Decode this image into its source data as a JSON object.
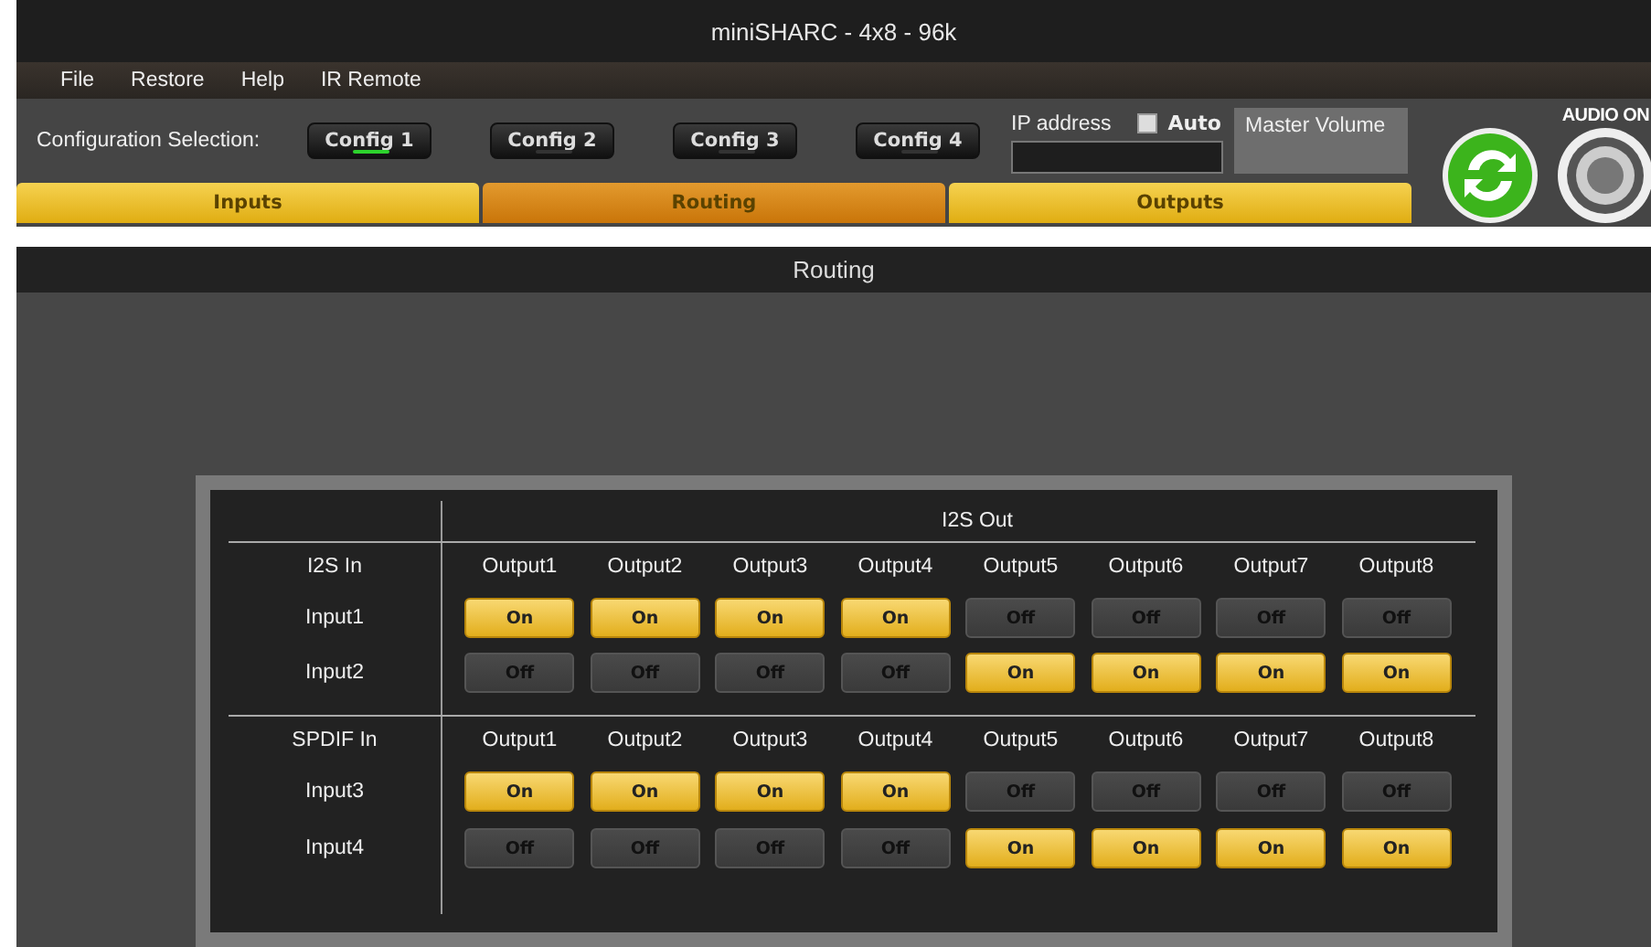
{
  "window": {
    "title": "miniSHARC - 4x8 - 96k"
  },
  "menu": [
    "File",
    "Restore",
    "Help",
    "IR Remote"
  ],
  "configuration": {
    "label": "Configuration Selection:",
    "presets": [
      {
        "label": "Config 1",
        "selected": true
      },
      {
        "label": "Config 2",
        "selected": false
      },
      {
        "label": "Config 3",
        "selected": false
      },
      {
        "label": "Config 4",
        "selected": false
      }
    ]
  },
  "ip_address": {
    "label": "IP address"
  },
  "auto": {
    "label": "Auto",
    "checked": false
  },
  "master_volume": {
    "label": "Master Volume"
  },
  "audio": {
    "label": "AUDIO ON"
  },
  "tabs": [
    {
      "label": "Inputs",
      "selected": false
    },
    {
      "label": "Routing",
      "selected": true
    },
    {
      "label": "Outputs",
      "selected": false
    }
  ],
  "section_title": "Routing",
  "matrix": {
    "out_header": "I2S Out",
    "groups": [
      {
        "header": "I2S In",
        "outputs": [
          "Output1",
          "Output2",
          "Output3",
          "Output4",
          "Output5",
          "Output6",
          "Output7",
          "Output8"
        ],
        "rows": [
          {
            "input": "Input1",
            "cells": [
              {
                "label": "On",
                "on": true
              },
              {
                "label": "On",
                "on": true
              },
              {
                "label": "On",
                "on": true
              },
              {
                "label": "On",
                "on": true
              },
              {
                "label": "Off",
                "on": false
              },
              {
                "label": "Off",
                "on": false
              },
              {
                "label": "Off",
                "on": false
              },
              {
                "label": "Off",
                "on": false
              }
            ]
          },
          {
            "input": "Input2",
            "cells": [
              {
                "label": "Off",
                "on": false
              },
              {
                "label": "Off",
                "on": false
              },
              {
                "label": "Off",
                "on": false
              },
              {
                "label": "Off",
                "on": false
              },
              {
                "label": "On",
                "on": true
              },
              {
                "label": "On",
                "on": true
              },
              {
                "label": "On",
                "on": true
              },
              {
                "label": "On",
                "on": true
              }
            ]
          }
        ]
      },
      {
        "header": "SPDIF In",
        "outputs": [
          "Output1",
          "Output2",
          "Output3",
          "Output4",
          "Output5",
          "Output6",
          "Output7",
          "Output8"
        ],
        "rows": [
          {
            "input": "Input3",
            "cells": [
              {
                "label": "On",
                "on": true
              },
              {
                "label": "On",
                "on": true
              },
              {
                "label": "On",
                "on": true
              },
              {
                "label": "On",
                "on": true
              },
              {
                "label": "Off",
                "on": false
              },
              {
                "label": "Off",
                "on": false
              },
              {
                "label": "Off",
                "on": false
              },
              {
                "label": "Off",
                "on": false
              }
            ]
          },
          {
            "input": "Input4",
            "cells": [
              {
                "label": "Off",
                "on": false
              },
              {
                "label": "Off",
                "on": false
              },
              {
                "label": "Off",
                "on": false
              },
              {
                "label": "Off",
                "on": false
              },
              {
                "label": "On",
                "on": true
              },
              {
                "label": "On",
                "on": true
              },
              {
                "label": "On",
                "on": true
              },
              {
                "label": "On",
                "on": true
              }
            ]
          }
        ]
      }
    ]
  }
}
